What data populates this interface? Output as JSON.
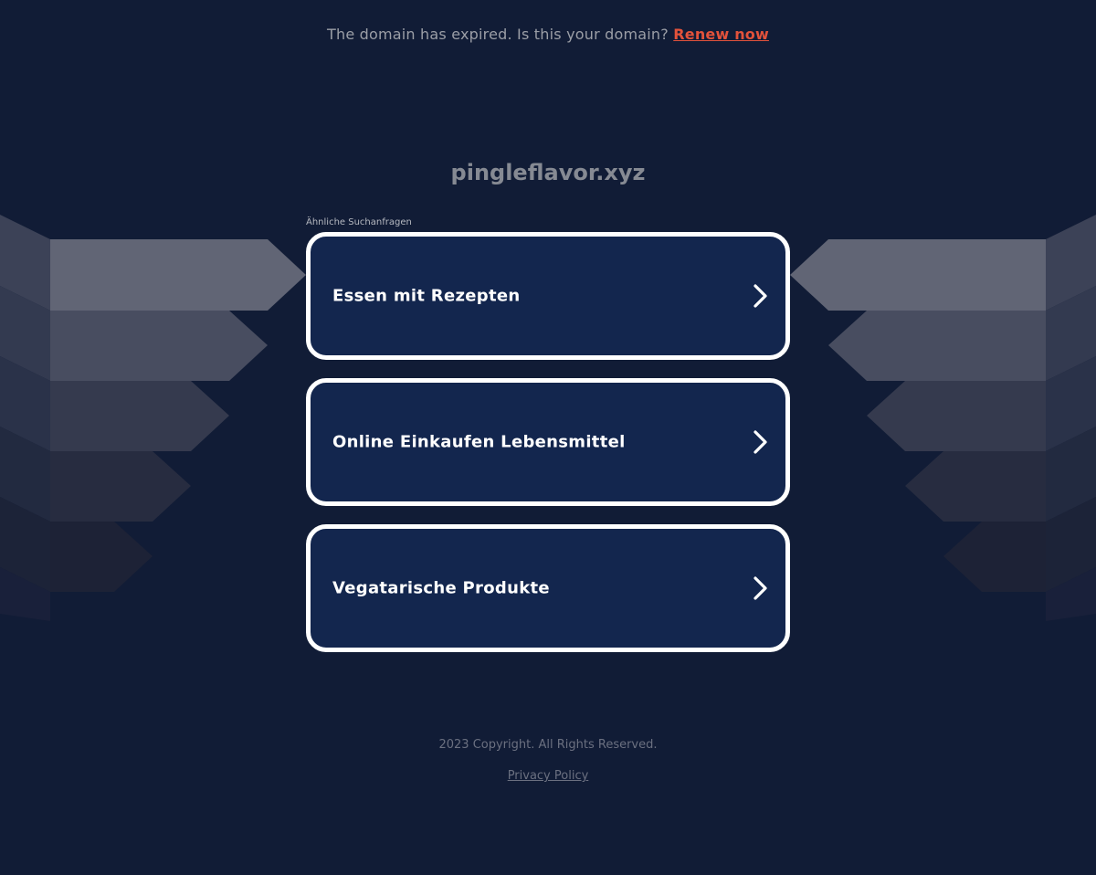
{
  "banner": {
    "text": "The domain has expired. Is this your domain?",
    "renew_label": "Renew now",
    "renew_color": "#e2523b"
  },
  "domain": {
    "name": "pingleflavor.xyz"
  },
  "related": {
    "label": "Ähnliche Suchanfragen",
    "items": [
      {
        "label": "Essen mit Rezepten",
        "icon": "chevron-right-icon"
      },
      {
        "label": "Online Einkaufen Lebensmittel",
        "icon": "chevron-right-icon"
      },
      {
        "label": "Vegatarische Produkte",
        "icon": "chevron-right-icon"
      }
    ]
  },
  "footer": {
    "copyright": "2023 Copyright. All Rights Reserved.",
    "privacy_label": "Privacy Policy"
  },
  "colors": {
    "background": "#111c36",
    "tile_background": "#13264e",
    "tile_border": "#ffffff"
  }
}
